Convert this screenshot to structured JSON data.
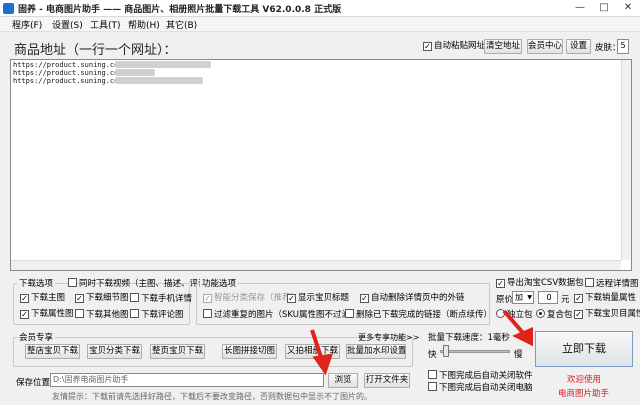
{
  "window": {
    "title": "固养 - 电商图片助手 —— 商品图片、相册照片批量下载工具 V62.0.0.8 正式版",
    "min_label": "—",
    "max_label": "□",
    "close_label": "✕"
  },
  "menu": [
    "程序(F)",
    "设置(S)",
    "工具(T)",
    "帮助(H)",
    "其它(B)"
  ],
  "top": {
    "url_label": "商品地址（一行一个网址）：",
    "auto_paste_label": "自动粘贴网址",
    "clear_button": "清空地址",
    "member_button": "会员中心",
    "settings_button": "设置",
    "skin_label": "皮肤：",
    "skin_value": "5"
  },
  "urls": [
    "https://product.suning.com/0",
    "https://product.suning.com/0",
    "https://product.suning.com/0"
  ],
  "download_options": {
    "title": "下载选项",
    "sync_video": "同时下载视频（主图、描述、评论）",
    "main_image": "下载主图",
    "detail_image": "下载细节图",
    "mobile_detail": "下载手机详情",
    "attribute_image": "下载属性图",
    "other_image": "下载其他图",
    "review_image": "下载评论图"
  },
  "function_options": {
    "title": "功能选项",
    "smart_category": "智能分类保存（推荐）",
    "show_title": "显示宝贝标题",
    "auto_delete": "自动删除详情页中的外链",
    "filter_duplicate": "过滤重复的图片（SKU属性图不过滤）",
    "delete_downloaded": "删除已下载完成的链接（断点续传）"
  },
  "export_options": {
    "export_csv": "导出淘宝CSV数据包",
    "remote_detail": "远程详情图",
    "price_label": "原价",
    "price_op": "加",
    "price_value": "0",
    "price_unit": "元",
    "sales_attr": "下载销量属性",
    "standalone_pkg": "独立包",
    "composite_pkg": "复合包",
    "item_attr": "下载宝贝目属性"
  },
  "member_zone": {
    "title": "会员专享",
    "more_link": "更多专享功能>>",
    "buttons": [
      "整店宝贝下载",
      "宝贝分类下载",
      "整页宝贝下载",
      "长图拼接切图",
      "又拍相册下载",
      "批量加水印设置"
    ]
  },
  "save": {
    "label": "保存位置：",
    "path": "D:\\固养电商图片助手",
    "browse_button": "浏览",
    "open_folder_button": "打开文件夹",
    "tip": "友情提示：下载前请先选择好路径，下载后不要改变路径，否则数据包中显示不了图片的。"
  },
  "speed": {
    "label": "批量下载速度：1毫秒",
    "fast_label": "快",
    "slow_label": "慢",
    "level": 0.05,
    "close_software": "下图完成后自动关闭软件",
    "shutdown": "下图完成后自动关闭电脑"
  },
  "start_button": "立即下载",
  "promo": {
    "line1": "欢迎使用",
    "line2": "电商图片助手"
  },
  "colors": {
    "accent": "#1e6fd0",
    "promo_red": "#d21f2a",
    "annotation_arrow": "#e0231b"
  },
  "icons": {
    "app": "app-icon",
    "checkmark": "✓",
    "spin_up": "▲",
    "spin_down": "▼"
  }
}
